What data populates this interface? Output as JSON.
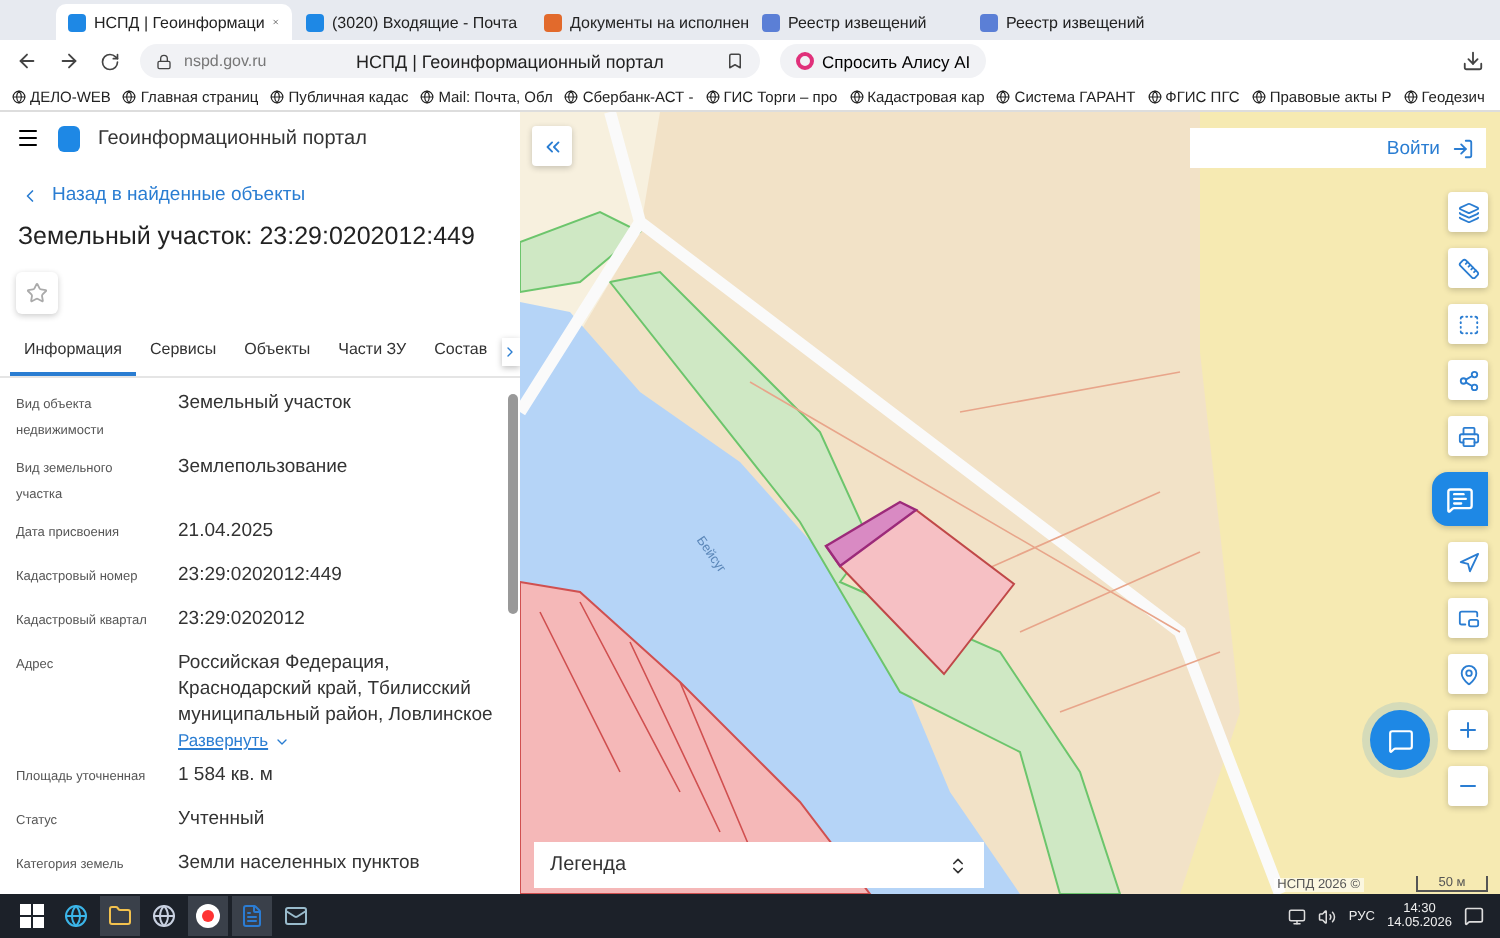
{
  "browser": {
    "tabs": [
      {
        "title": "НСПД | Геоинформаци",
        "selected": true
      },
      {
        "title": "(3020) Входящие - Почта",
        "selected": false
      },
      {
        "title": "Документы на исполнен",
        "selected": false
      },
      {
        "title": "Реестр извещений",
        "selected": false
      },
      {
        "title": "Реестр извещений",
        "selected": false
      }
    ],
    "address": "nspd.gov.ru",
    "page_title": "НСПД | Геоинформационный портал",
    "assistant_button": "Спросить Алису AI",
    "bookmarks": [
      "ДЕЛО-WEB",
      "Главная страниц",
      "Публичная кадас",
      "Mail: Почта, Обл",
      "Сбербанк-АСТ - ",
      "ГИС Торги – про",
      "Кадастровая кар",
      "Система ГАРАНТ",
      "ФГИС ПГС",
      "Правовые акты Р",
      "Геодезич"
    ]
  },
  "portal": {
    "title": "Геоинформационный портал",
    "back_link": "Назад в найденные объекты",
    "object_title": "Земельный участок: 23:29:0202012:449",
    "tabs": [
      {
        "label": "Информация",
        "selected": true
      },
      {
        "label": "Сервисы",
        "selected": false
      },
      {
        "label": "Объекты",
        "selected": false
      },
      {
        "label": "Части ЗУ",
        "selected": false
      },
      {
        "label": "Состав",
        "selected": false
      }
    ],
    "fields": [
      {
        "label": "Вид объекта недвижимости",
        "value": "Земельный участок"
      },
      {
        "label": "Вид земельного участка",
        "value": "Землепользование"
      },
      {
        "label": "Дата присвоения",
        "value": "21.04.2025"
      },
      {
        "label": "Кадастровый номер",
        "value": "23:29:0202012:449"
      },
      {
        "label": "Кадастровый квартал",
        "value": "23:29:0202012"
      },
      {
        "label": "Адрес",
        "value": "Российская Федерация, Краснодарский край, Тбилисский муниципальный район, Ловлинское",
        "link": "Развернуть"
      },
      {
        "label": "Площадь уточненная",
        "value": "1 584 кв. м"
      },
      {
        "label": "Статус",
        "value": "Учтенный"
      },
      {
        "label": "Категория земель",
        "value": "Земли населенных пунктов"
      }
    ]
  },
  "map": {
    "login_button": "Войти",
    "river_label": "Бейсуг",
    "legend": "Легенда",
    "attribution": "НСПД 2026 ©",
    "scale": "50 м",
    "tools": [
      {
        "kind": "layers",
        "active": false
      },
      {
        "kind": "ruler",
        "active": false
      },
      {
        "kind": "select",
        "active": false
      },
      {
        "kind": "share",
        "active": false
      },
      {
        "kind": "print",
        "active": false
      },
      {
        "kind": "badge",
        "active": true
      },
      {
        "kind": "navigate",
        "active": false
      },
      {
        "kind": "frame",
        "active": false
      },
      {
        "kind": "pin",
        "active": false
      },
      {
        "kind": "plus",
        "active": false
      },
      {
        "kind": "minus",
        "active": false
      }
    ]
  },
  "taskbar": {
    "language": "РУС",
    "time": "14:30",
    "date": "14.05.2026"
  }
}
